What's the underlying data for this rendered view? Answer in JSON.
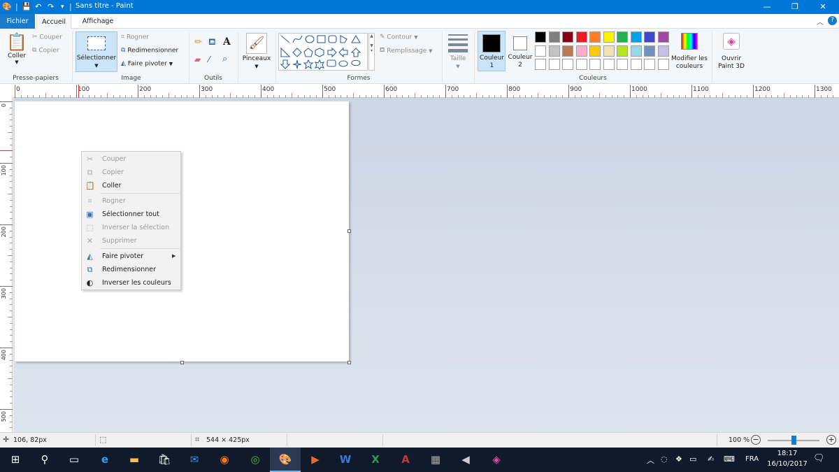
{
  "window": {
    "title": "Sans titre - Paint",
    "minimize": "—",
    "maximize": "❐",
    "close": "✕"
  },
  "tabs": {
    "file": "Fichier",
    "home": "Accueil",
    "view": "Affichage"
  },
  "ribbon": {
    "clipboard": {
      "paste": "Coller",
      "cut": "Couper",
      "copy": "Copier",
      "label": "Presse-papiers"
    },
    "image": {
      "select": "Sélectionner",
      "crop": "Rogner",
      "resize": "Redimensionner",
      "rotate": "Faire pivoter",
      "label": "Image"
    },
    "tools": {
      "label": "Outils"
    },
    "brushes": {
      "label": "Pinceaux"
    },
    "shapes": {
      "outline": "Contour",
      "fill": "Remplissage",
      "label": "Formes"
    },
    "size": {
      "label": "Taille"
    },
    "colors": {
      "color1": "Couleur 1",
      "color2": "Couleur 2",
      "edit": "Modifier les couleurs",
      "label": "Couleurs",
      "palette_row1": [
        "#000000",
        "#7f7f7f",
        "#880015",
        "#ed1c24",
        "#ff7f27",
        "#fff200",
        "#22b14c",
        "#00a2e8",
        "#3f48cc",
        "#a349a4"
      ],
      "palette_row2": [
        "#ffffff",
        "#c3c3c3",
        "#b97a57",
        "#ffaec9",
        "#ffc90e",
        "#efe4b0",
        "#b5e61d",
        "#99d9ea",
        "#7092be",
        "#c8bfe7"
      ]
    },
    "paint3d": "Ouvrir Paint 3D"
  },
  "ruler": {
    "h_labels": [
      "0",
      "100",
      "200",
      "300",
      "400",
      "500",
      "600",
      "700",
      "800",
      "900",
      "1000",
      "1100",
      "1200",
      "1300"
    ],
    "v_labels": [
      "0",
      "100",
      "200",
      "300",
      "400",
      "500"
    ]
  },
  "context_menu": [
    {
      "label": "Couper",
      "icon": "scissors-icon",
      "enabled": false
    },
    {
      "label": "Copier",
      "icon": "copy-icon",
      "enabled": false
    },
    {
      "label": "Coller",
      "icon": "paste-icon",
      "enabled": true
    },
    {
      "label": "Rogner",
      "icon": "crop-icon",
      "enabled": false
    },
    {
      "label": "Sélectionner tout",
      "icon": "select-all-icon",
      "enabled": true
    },
    {
      "label": "Inverser la sélection",
      "icon": "invert-selection-icon",
      "enabled": false
    },
    {
      "label": "Supprimer",
      "icon": "delete-icon",
      "enabled": false
    },
    {
      "label": "Faire pivoter",
      "icon": "rotate-icon",
      "enabled": true
    },
    {
      "label": "Redimensionner",
      "icon": "resize-icon",
      "enabled": true
    },
    {
      "label": "Inverser les couleurs",
      "icon": "invert-colors-icon",
      "enabled": true
    }
  ],
  "status": {
    "cursor": "106, 82px",
    "canvas_size": "544 × 425px",
    "zoom": "100 %"
  },
  "taskbar": {
    "lang": "FRA",
    "time": "18:17",
    "date": "16/10/2017"
  }
}
